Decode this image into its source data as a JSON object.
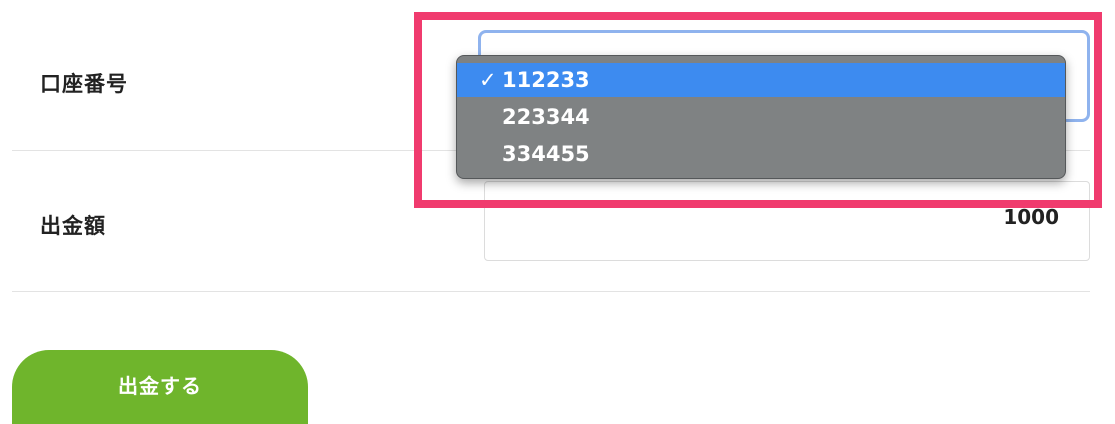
{
  "form": {
    "account_label": "口座番号",
    "amount_label": "出金額",
    "amount_value": "1000",
    "submit_label": "出金する"
  },
  "account_select": {
    "options": [
      "112233",
      "223344",
      "334455"
    ],
    "selected": "112233",
    "check_mark": "✓"
  },
  "colors": {
    "highlight_border": "#f03b6e",
    "submit_button": "#6fb52c",
    "selected_option": "#3d8bf0",
    "dropdown_background": "#7f8283",
    "focus_ring": "#8fb3ee"
  }
}
